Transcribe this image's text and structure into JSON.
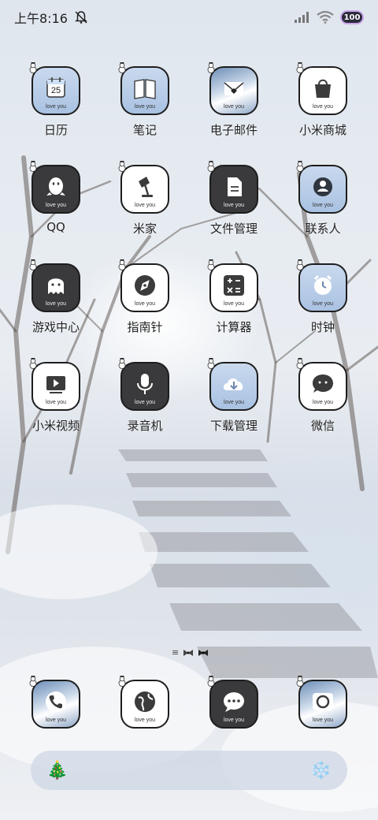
{
  "status_bar": {
    "time": "上午8:16",
    "battery": "100"
  },
  "apps": [
    {
      "label": "日历",
      "style": "blue",
      "icon": "calendar-icon",
      "badge_text": "25",
      "tile_text": "love you"
    },
    {
      "label": "笔记",
      "style": "blue",
      "icon": "notebook-icon",
      "tile_text": "love you"
    },
    {
      "label": "电子邮件",
      "style": "photo",
      "icon": "envelope-icon",
      "tile_text": "love you"
    },
    {
      "label": "小米商城",
      "style": "white",
      "icon": "shopping-bag-icon",
      "tile_text": "love you"
    },
    {
      "label": "QQ",
      "style": "dark",
      "icon": "penguin-icon",
      "tile_text": "love you"
    },
    {
      "label": "米家",
      "style": "white",
      "icon": "lamp-icon",
      "tile_text": "love you"
    },
    {
      "label": "文件管理",
      "style": "dark",
      "icon": "document-icon",
      "tile_text": "love you"
    },
    {
      "label": "联系人",
      "style": "blue",
      "icon": "person-icon",
      "tile_text": "love you"
    },
    {
      "label": "游戏中心",
      "style": "dark",
      "icon": "ghost-icon",
      "tile_text": "love you"
    },
    {
      "label": "指南针",
      "style": "white",
      "icon": "compass-icon",
      "tile_text": "love you"
    },
    {
      "label": "计算器",
      "style": "white",
      "icon": "calculator-icon",
      "tile_text": "love you"
    },
    {
      "label": "时钟",
      "style": "blue",
      "icon": "alarm-clock-icon",
      "tile_text": "love you"
    },
    {
      "label": "小米视频",
      "style": "white",
      "icon": "video-play-icon",
      "tile_text": "love you"
    },
    {
      "label": "录音机",
      "style": "dark",
      "icon": "microphone-icon",
      "tile_text": "love you"
    },
    {
      "label": "下载管理",
      "style": "blue",
      "icon": "cloud-download-icon",
      "tile_text": "love you"
    },
    {
      "label": "微信",
      "style": "white",
      "icon": "chat-bubble-icon",
      "tile_text": "love you"
    }
  ],
  "dock": [
    {
      "style": "photo",
      "icon": "phone-icon",
      "tile_text": "love you"
    },
    {
      "style": "white",
      "icon": "globe-icon",
      "tile_text": "love you"
    },
    {
      "style": "dark",
      "icon": "message-icon",
      "tile_text": "love you"
    },
    {
      "style": "photo",
      "icon": "camera-icon",
      "tile_text": "love you"
    }
  ],
  "page_indicator": {
    "icons": [
      "menu-lines-icon",
      "bow-icon",
      "bow-icon"
    ]
  },
  "search_bar": {
    "left_icon": "christmas-tree-icon",
    "right_icon": "snowflake-icon"
  },
  "colors": {
    "tile_border": "#1d1d1d",
    "tile_dark": "#3a3a3c",
    "tile_blue": "#b8cde8",
    "label": "#222222"
  }
}
